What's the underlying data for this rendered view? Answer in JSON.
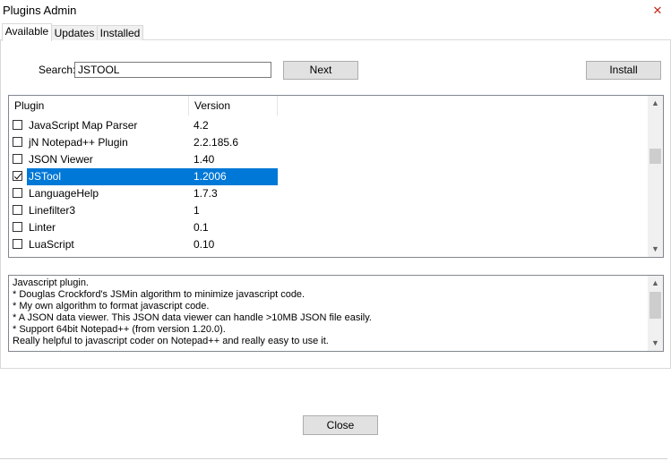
{
  "window": {
    "title": "Plugins Admin",
    "close_glyph": "✕"
  },
  "tabs": [
    {
      "label": "Available",
      "active": true
    },
    {
      "label": "Updates",
      "active": false
    },
    {
      "label": "Installed",
      "active": false
    }
  ],
  "search": {
    "label": "Search:",
    "value": "JSTOOL"
  },
  "buttons": {
    "next": "Next",
    "install": "Install",
    "close": "Close"
  },
  "list": {
    "columns": [
      "Plugin",
      "Version"
    ],
    "rows": [
      {
        "name": "JavaScript Map Parser",
        "version": "4.2",
        "checked": false,
        "selected": false
      },
      {
        "name": "jN Notepad++ Plugin",
        "version": "2.2.185.6",
        "checked": false,
        "selected": false
      },
      {
        "name": "JSON Viewer",
        "version": "1.40",
        "checked": false,
        "selected": false
      },
      {
        "name": "JSTool",
        "version": "1.2006",
        "checked": true,
        "selected": true
      },
      {
        "name": "LanguageHelp",
        "version": "1.7.3",
        "checked": false,
        "selected": false
      },
      {
        "name": "Linefilter3",
        "version": "1",
        "checked": false,
        "selected": false
      },
      {
        "name": "Linter",
        "version": "0.1",
        "checked": false,
        "selected": false
      },
      {
        "name": "LuaScript",
        "version": "0.10",
        "checked": false,
        "selected": false
      }
    ]
  },
  "description": {
    "lines": [
      "Javascript plugin.",
      " * Douglas Crockford's JSMin algorithm to minimize javascript code.",
      " * My own algorithm to format javascript code.",
      " * A JSON data viewer. This JSON data viewer can handle >10MB JSON file easily.",
      " * Support 64bit Notepad++ (from version 1.20.0).",
      "Really helpful to javascript coder on Notepad++ and really easy to use it."
    ]
  },
  "icons": {
    "scroll_up": "▲",
    "scroll_down": "▼"
  },
  "colors": {
    "selection": "#0078d7",
    "close_red": "#c42b1c"
  }
}
